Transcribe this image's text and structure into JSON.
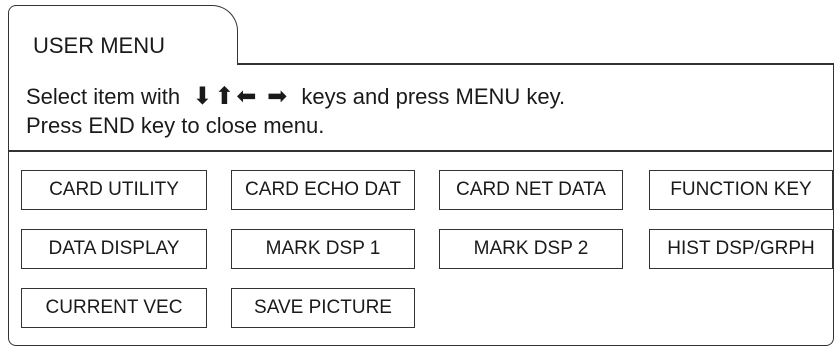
{
  "menu": {
    "title": "USER MENU",
    "instruction_prefix": "Select item with",
    "arrow_keys": "⬇⬆⬅ ➡",
    "instruction_suffix": "keys and press MENU key.",
    "instruction_line2": "Press END key to close menu.",
    "items": [
      {
        "label": "CARD UTILITY"
      },
      {
        "label": "CARD ECHO DAT"
      },
      {
        "label": "CARD NET DATA"
      },
      {
        "label": "FUNCTION KEY"
      },
      {
        "label": "DATA DISPLAY"
      },
      {
        "label": "MARK DSP 1"
      },
      {
        "label": "MARK DSP 2"
      },
      {
        "label": "HIST DSP/GRPH"
      },
      {
        "label": "CURRENT VEC"
      },
      {
        "label": "SAVE PICTURE"
      }
    ]
  }
}
